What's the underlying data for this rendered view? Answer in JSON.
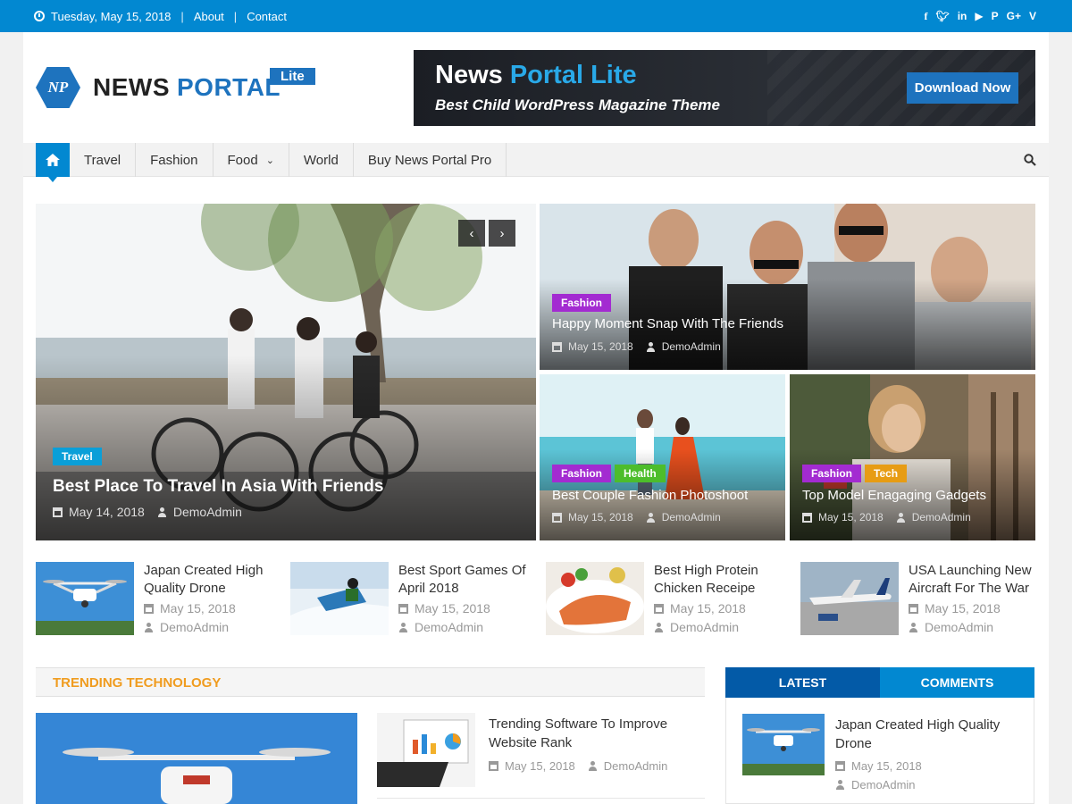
{
  "topbar": {
    "date": "Tuesday, May 15, 2018",
    "links": [
      "About",
      "Contact"
    ],
    "socials": [
      "f",
      "t",
      "in",
      "yt",
      "p",
      "G+",
      "v"
    ]
  },
  "logo": {
    "mark": "NP",
    "word1": "NEWS",
    "word2": "PORTAL",
    "badge": "Lite"
  },
  "banner": {
    "title_a": "News ",
    "title_b": "Portal Lite",
    "subtitle": "Best Child WordPress Magazine Theme",
    "button": "Download Now"
  },
  "nav": {
    "items": [
      "Travel",
      "Fashion",
      "Food",
      "World",
      "Buy News Portal Pro"
    ]
  },
  "featured": {
    "main": {
      "category": "Travel",
      "title": "Best Place To Travel In Asia With Friends",
      "date": "May 14, 2018",
      "author": "DemoAdmin"
    },
    "top_right": {
      "category": "Fashion",
      "title": "Happy Moment Snap With The Friends",
      "date": "May 15, 2018",
      "author": "DemoAdmin"
    },
    "bottom_left": {
      "categories": [
        "Fashion",
        "Health"
      ],
      "title": "Best Couple Fashion Photoshoot",
      "date": "May 15, 2018",
      "author": "DemoAdmin"
    },
    "bottom_right": {
      "categories": [
        "Fashion",
        "Tech"
      ],
      "title": "Top Model Enagaging Gadgets",
      "date": "May 15, 2018",
      "author": "DemoAdmin"
    }
  },
  "small_posts": [
    {
      "title": "Japan Created High Quality Drone",
      "date": "May 15, 2018",
      "author": "DemoAdmin"
    },
    {
      "title": "Best Sport Games Of April 2018",
      "date": "May 15, 2018",
      "author": "DemoAdmin"
    },
    {
      "title": "Best High Protein Chicken Receipe",
      "date": "May 15, 2018",
      "author": "DemoAdmin"
    },
    {
      "title": "USA Launching New Aircraft For The War",
      "date": "May 15, 2018",
      "author": "DemoAdmin"
    }
  ],
  "trending": {
    "heading": "TRENDING TECHNOLOGY",
    "post": {
      "title": "Trending Software To Improve Website Rank",
      "date": "May 15, 2018",
      "author": "DemoAdmin"
    }
  },
  "tabs_widget": {
    "tabs": [
      "LATEST",
      "COMMENTS"
    ],
    "post": {
      "title": "Japan Created High Quality Drone",
      "date": "May 15, 2018",
      "author": "DemoAdmin"
    }
  },
  "colors": {
    "primary": "#0288d1",
    "dark_blue": "#035aa7",
    "fashion": "#a32bd1",
    "health": "#4dbd2b",
    "tech": "#e79c14",
    "travel": "#0a9fd8",
    "trending": "#f09c1f"
  }
}
